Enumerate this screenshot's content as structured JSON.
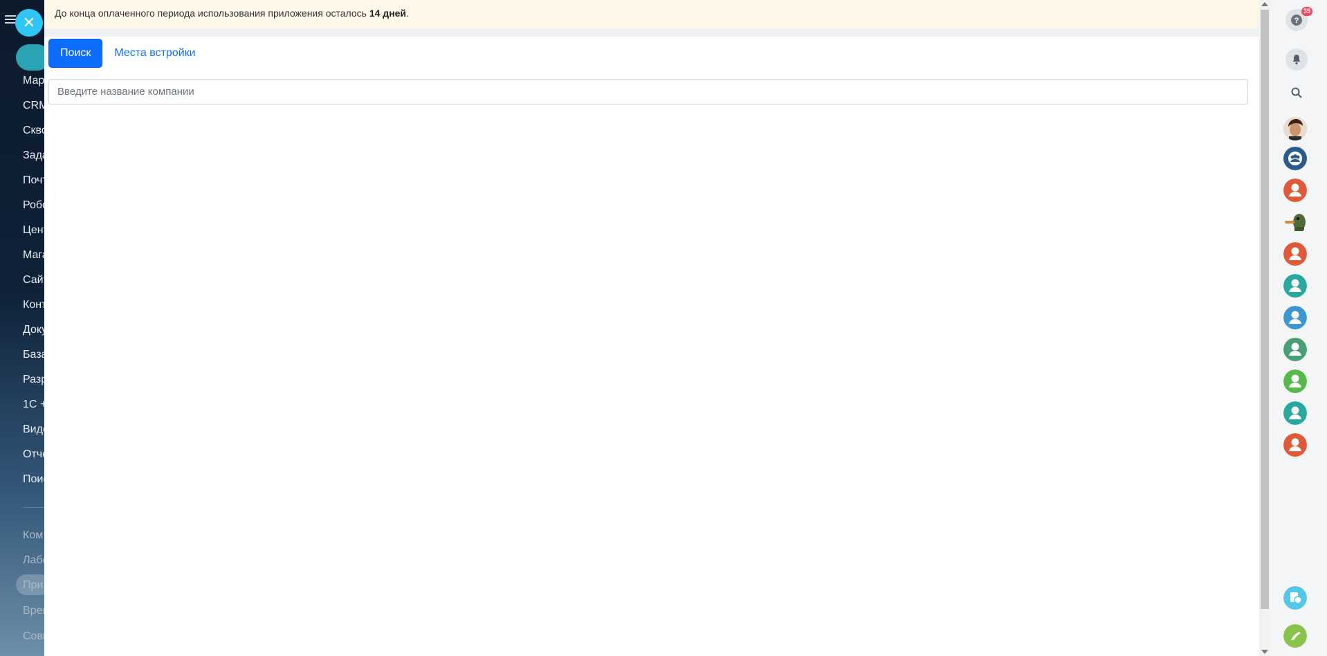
{
  "background_sidebar": {
    "items": [
      "Мар",
      "CRM",
      "Скво",
      "Зада",
      "Почт",
      "Робо",
      "Цент",
      "Мага",
      "Сайт",
      "Конт",
      "Доку",
      "База",
      "Разр",
      "1С +",
      "Виде",
      "Отче",
      "Поис"
    ],
    "items_secondary": [
      "Ком",
      "Лабо",
      "При",
      "Врем",
      "Совм"
    ]
  },
  "close_button": {
    "icon": "close-icon",
    "glyph": "✕"
  },
  "notice": {
    "text_before": "До конца оплаченного периода использования приложения осталось ",
    "bold": "14 дней",
    "text_after": "."
  },
  "tabs": {
    "search": "Поиск",
    "places": "Места встройки"
  },
  "search": {
    "placeholder": "Введите название компании",
    "value": ""
  },
  "rightbar": {
    "help_badge": "35",
    "avatar_colors": [
      "#2b5a8e",
      "#e05a3a",
      "#e05a3a",
      "#27a9a0",
      "#3c96cf",
      "#4a9e75",
      "#57b84c",
      "#27a9a0",
      "#e05a3a"
    ]
  },
  "colors": {
    "accent": "#0d6efd",
    "close": "#2fc6f6",
    "notice_bg": "#fcf7e8"
  }
}
